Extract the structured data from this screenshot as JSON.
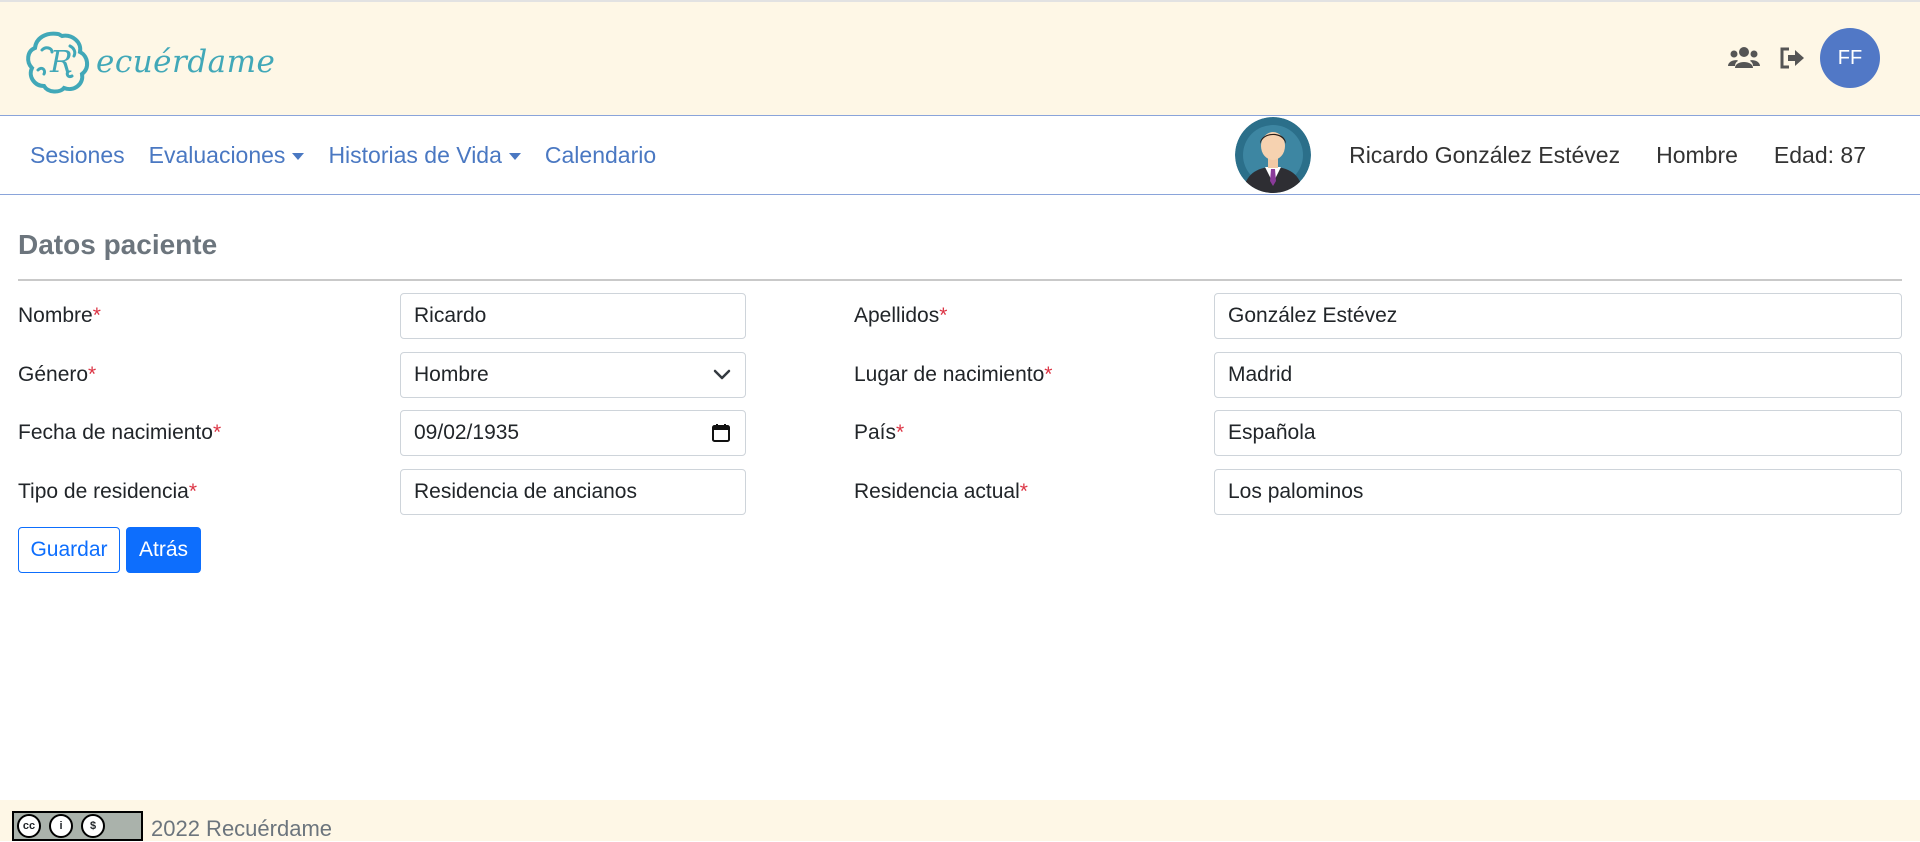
{
  "app": {
    "name": "Recuérdame"
  },
  "header": {
    "user_initials": "FF",
    "icons": [
      "users-icon",
      "sign-out-icon"
    ]
  },
  "nav": {
    "items": [
      {
        "label": "Sesiones",
        "dropdown": false
      },
      {
        "label": "Evaluaciones",
        "dropdown": true
      },
      {
        "label": "Historias de Vida",
        "dropdown": true
      },
      {
        "label": "Calendario",
        "dropdown": false
      }
    ]
  },
  "patient": {
    "name": "Ricardo González Estévez",
    "gender": "Hombre",
    "age_label": "Edad:",
    "age": "87"
  },
  "form": {
    "title": "Datos paciente",
    "required_marker": "*",
    "fields": {
      "nombre": {
        "label": "Nombre",
        "value": "Ricardo"
      },
      "apellidos": {
        "label": "Apellidos",
        "value": "González Estévez"
      },
      "genero": {
        "label": "Género",
        "value": "Hombre"
      },
      "lugar_nacimiento": {
        "label": "Lugar de nacimiento",
        "value": "Madrid"
      },
      "fecha_nacimiento": {
        "label": "Fecha de nacimiento",
        "value": "09/02/1935"
      },
      "pais": {
        "label": "País",
        "value": "Española"
      },
      "tipo_residencia": {
        "label": "Tipo de residencia",
        "value": "Residencia de ancianos"
      },
      "residencia_actual": {
        "label": "Residencia actual",
        "value": "Los palominos"
      }
    },
    "buttons": {
      "save": "Guardar",
      "back": "Atrás"
    }
  },
  "footer": {
    "text": "2022 Recuérdame"
  },
  "colors": {
    "header_bg": "#fef7e6",
    "nav_link": "#4a78c2",
    "primary": "#0d6efd",
    "required": "#dc3545",
    "avatar_bg": "#5178c6",
    "logo": "#41a8b8"
  }
}
